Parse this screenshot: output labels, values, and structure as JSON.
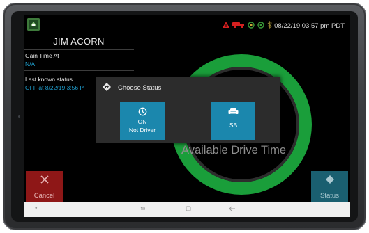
{
  "status_bar": {
    "datetime": "08/22/19 03:57 pm PDT",
    "icons": [
      "warning-icon",
      "truck-icon",
      "gps-icon",
      "sync-icon",
      "bluetooth-icon"
    ],
    "colors": {
      "warning": "#d42020",
      "truck": "#d42020",
      "gps": "#3a9d3a"
    }
  },
  "driver": {
    "name": "JIM ACORN",
    "gain_time_label": "Gain Time At",
    "gain_time_value": "N/A",
    "last_status_label": "Last known status",
    "last_status_value": "OFF at 8/22/19 3:56 P"
  },
  "main": {
    "available_drive_time_label": "Available Drive Time",
    "gauge_color": "#1a9e3a"
  },
  "dialog": {
    "title": "Choose Status",
    "options": [
      {
        "line1": "ON",
        "line2": "Not Driver",
        "icon": "clock-icon"
      },
      {
        "line1": "SB",
        "icon": "sofa-icon"
      }
    ],
    "accent": "#1b87ad"
  },
  "actions": {
    "cancel_label": "Cancel",
    "status_label": "Status"
  },
  "nav": {
    "icons": [
      "dot-icon",
      "recents-arrows-icon",
      "home-square-icon",
      "back-arrow-icon"
    ]
  }
}
